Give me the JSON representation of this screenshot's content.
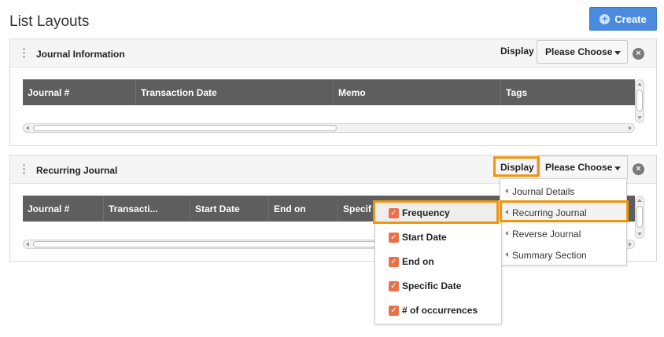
{
  "page": {
    "title": "List Layouts",
    "create_label": "Create",
    "accent_color": "#f0960e",
    "button_color": "#4a8be0"
  },
  "panels": [
    {
      "title": "Journal Information",
      "display_label": "Display",
      "select_value": "Please Choose",
      "columns": [
        "Journal #",
        "Transaction Date",
        "Memo",
        "Tags"
      ]
    },
    {
      "title": "Recurring Journal",
      "display_label": "Display",
      "select_value": "Please Choose",
      "columns": [
        "Journal #",
        "Transacti...",
        "Start Date",
        "End on",
        "Specif"
      ]
    }
  ],
  "display_menu": {
    "items": [
      "Journal Details",
      "Recurring Journal",
      "Reverse Journal",
      "Summary Section"
    ],
    "highlighted": "Recurring Journal"
  },
  "fields_submenu": {
    "items": [
      {
        "label": "Frequency",
        "checked": true
      },
      {
        "label": "Start Date",
        "checked": true
      },
      {
        "label": "End on",
        "checked": true
      },
      {
        "label": "Specific Date",
        "checked": true
      },
      {
        "label": "# of occurrences",
        "checked": true
      }
    ],
    "icons": {
      "checkbox": "checkbox-checked-icon"
    }
  },
  "icons": {
    "create": "plus-circle-icon",
    "close": "close-circle-icon",
    "caret": "chevron-down-icon",
    "drag": "drag-handle-icon"
  }
}
